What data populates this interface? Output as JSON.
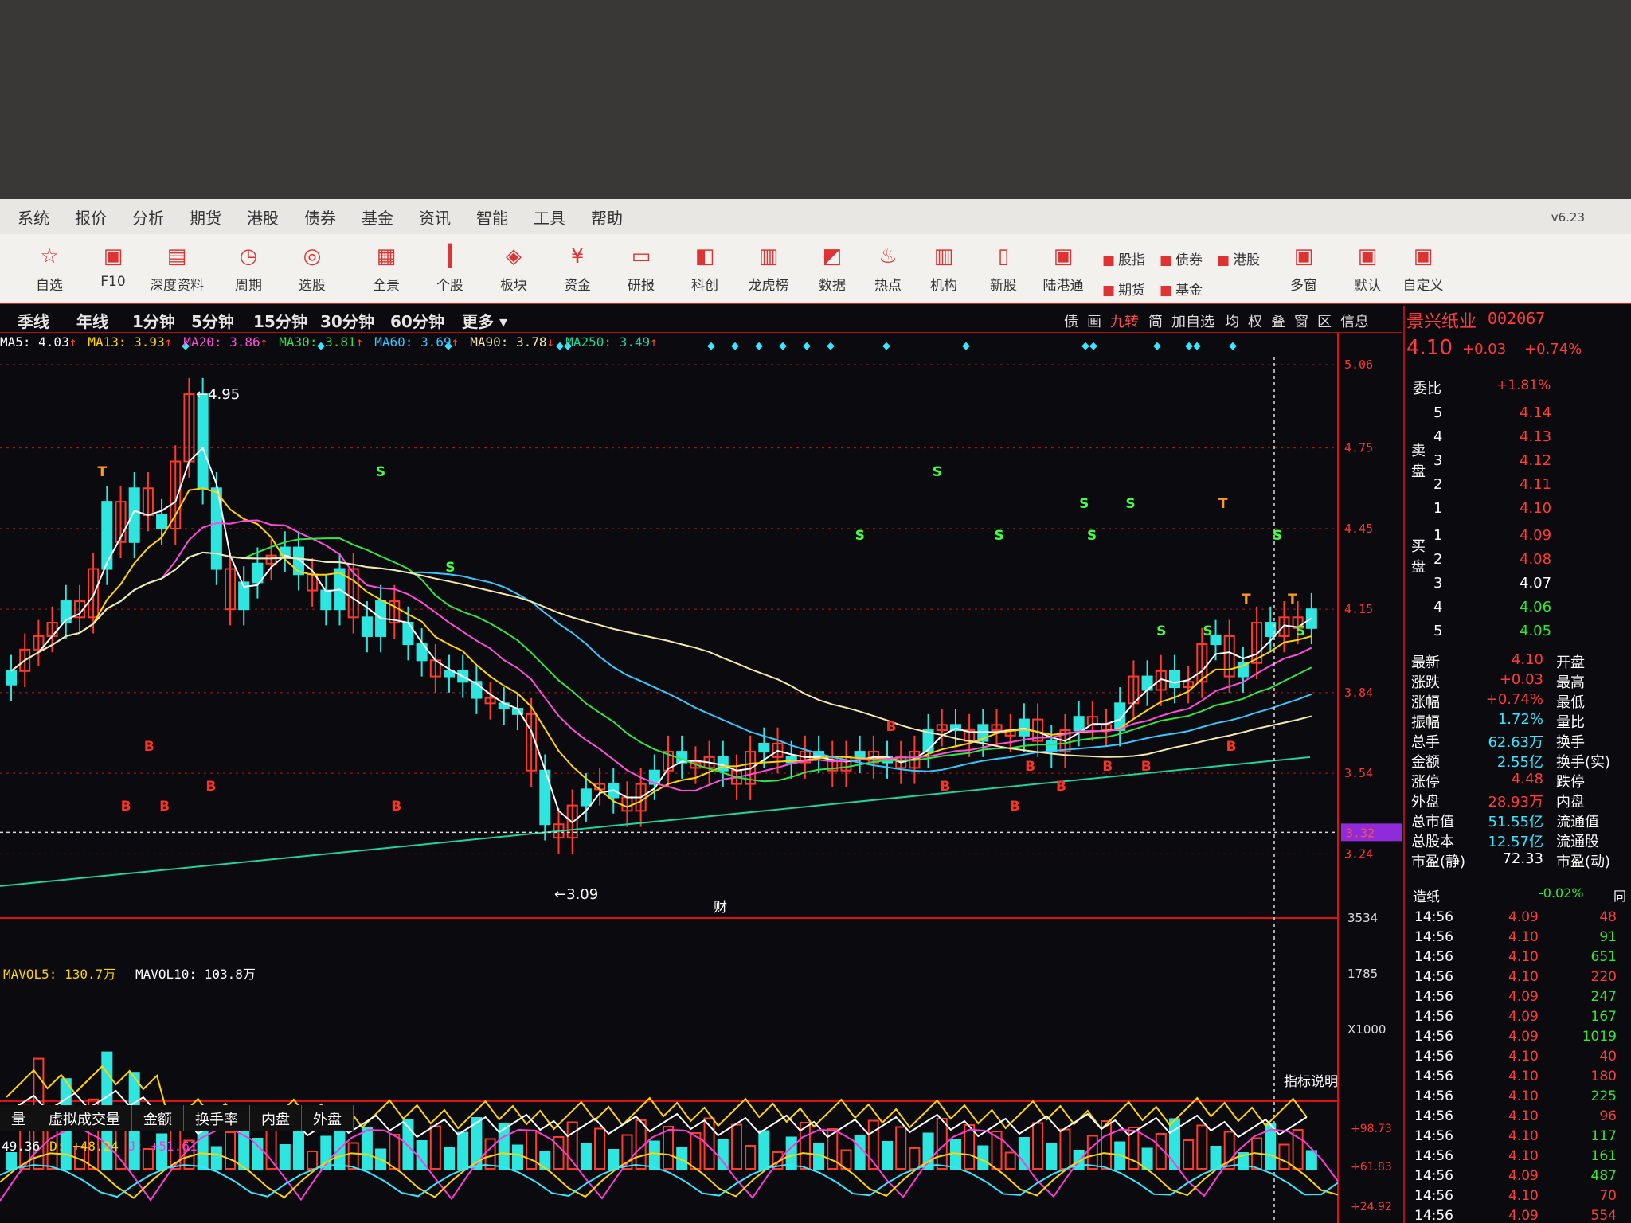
{
  "menu": [
    "系统",
    "报价",
    "分析",
    "期货",
    "港股",
    "债券",
    "基金",
    "资讯",
    "智能",
    "工具",
    "帮助"
  ],
  "version": "v6.23",
  "toolbar": [
    {
      "icon": "star-icon",
      "glyph": "☆",
      "label": "自选"
    },
    {
      "icon": "f10-icon",
      "glyph": "▣",
      "label": "F10"
    },
    {
      "icon": "f9-icon",
      "glyph": "▤",
      "label": "深度资料"
    },
    {
      "icon": "clock-icon",
      "glyph": "◷",
      "label": "周期"
    },
    {
      "icon": "select-stock-icon",
      "glyph": "◎",
      "label": "选股"
    },
    {
      "icon": "grid-icon",
      "glyph": "▦",
      "label": "全景"
    },
    {
      "icon": "candle-icon",
      "glyph": "┃",
      "label": "个股"
    },
    {
      "icon": "layers-icon",
      "glyph": "◈",
      "label": "板块"
    },
    {
      "icon": "yen-icon",
      "glyph": "¥",
      "label": "资金"
    },
    {
      "icon": "report-icon",
      "glyph": "▭",
      "label": "研报"
    },
    {
      "icon": "kechuang-icon",
      "glyph": "◧",
      "label": "科创"
    },
    {
      "icon": "bar-icon",
      "glyph": "▥",
      "label": "龙虎榜"
    },
    {
      "icon": "line-chart-icon",
      "glyph": "◩",
      "label": "数据"
    },
    {
      "icon": "fire-icon",
      "glyph": "♨",
      "label": "热点"
    },
    {
      "icon": "building-icon",
      "glyph": "▥",
      "label": "机构"
    },
    {
      "icon": "ipo-icon",
      "glyph": "▯",
      "label": "新股"
    },
    {
      "icon": "hk-connect-icon",
      "glyph": "▣",
      "label": "陆港通"
    }
  ],
  "toolbar_small": [
    "股指",
    "债券",
    "港股",
    "期货",
    "基金"
  ],
  "toolbar_right": [
    "多窗",
    "默认",
    "自定义"
  ],
  "periods": [
    "季线",
    "年线",
    "1分钟",
    "5分钟",
    "15分钟",
    "30分钟",
    "60分钟",
    "更多"
  ],
  "right_tools": [
    "债",
    "画",
    "九转",
    "简",
    "加自选",
    "均",
    "权",
    "叠",
    "窗",
    "区",
    "信息"
  ],
  "ma_legend": [
    {
      "text": "MA5: 4.03",
      "color": "#ffffff",
      "arrow": "↑"
    },
    {
      "text": "MA13: 3.93",
      "color": "#ffd400",
      "arrow": "↑"
    },
    {
      "text": "MA20: 3.86",
      "color": "#ff4fd8",
      "arrow": "↑"
    },
    {
      "text": "MA30: 3.81",
      "color": "#36e24a",
      "arrow": "↑"
    },
    {
      "text": "MA60: 3.69",
      "color": "#38c8ff",
      "arrow": "↑"
    },
    {
      "text": "MA90: 3.78",
      "color": "#f4e7b0",
      "arrow": "↓"
    },
    {
      "text": "MA250: 3.49",
      "color": "#22d39a",
      "arrow": "↑"
    }
  ],
  "price_axis": [
    "5.06",
    "4.75",
    "4.45",
    "4.15",
    "3.84",
    "3.54",
    "3.24"
  ],
  "crosshair_price": "3.32",
  "high_label": "4.95",
  "low_label": "3.09",
  "cai_label": "财",
  "vol_legend": {
    "mavol5": "MAVOL5: 130.7万",
    "mavol10": "MAVOL10: 103.8万"
  },
  "vol_axis": [
    "3534",
    "1785",
    "X1000"
  ],
  "kdj_legend": {
    "k": "49.36",
    "d": "D: +48.24",
    "j": "J: +51.61"
  },
  "kdj_axis": [
    "+98.73",
    "+61.83",
    "+24.92"
  ],
  "indicator_help": "指标说明",
  "subtabs": [
    "量",
    "虚拟成交量",
    "金额",
    "换手率",
    "内盘",
    "外盘"
  ],
  "stock": {
    "name": "景兴纸业",
    "code": "002067",
    "price": "4.10",
    "change": "+0.03",
    "pct": "+0.74%"
  },
  "weibi": {
    "label": "委比",
    "value": "+1.81%"
  },
  "sell_label": "卖盘",
  "buy_label": "买盘",
  "asks": [
    {
      "n": "5",
      "p": "4.14"
    },
    {
      "n": "4",
      "p": "4.13"
    },
    {
      "n": "3",
      "p": "4.12"
    },
    {
      "n": "2",
      "p": "4.11"
    },
    {
      "n": "1",
      "p": "4.10"
    }
  ],
  "bids": [
    {
      "n": "1",
      "p": "4.09"
    },
    {
      "n": "2",
      "p": "4.08"
    },
    {
      "n": "3",
      "p": "4.07"
    },
    {
      "n": "4",
      "p": "4.06"
    },
    {
      "n": "5",
      "p": "4.05"
    }
  ],
  "quote": [
    {
      "k": "最新",
      "v": "4.10",
      "k2": "开盘"
    },
    {
      "k": "涨跌",
      "v": "+0.03",
      "k2": "最高"
    },
    {
      "k": "涨幅",
      "v": "+0.74%",
      "k2": "最低"
    },
    {
      "k": "振幅",
      "v": "1.72%",
      "k2": "量比"
    },
    {
      "k": "总手",
      "v": "62.63万",
      "k2": "换手"
    },
    {
      "k": "金额",
      "v": "2.55亿",
      "k2": "换手(实)"
    },
    {
      "k": "涨停",
      "v": "4.48",
      "k2": "跌停"
    },
    {
      "k": "外盘",
      "v": "28.93万",
      "k2": "内盘"
    },
    {
      "k": "总市值",
      "v": "51.55亿",
      "k2": "流通值"
    },
    {
      "k": "总股本",
      "v": "12.57亿",
      "k2": "流通股"
    },
    {
      "k": "市盈(静)",
      "v": "72.33",
      "k2": "市盈(动)"
    }
  ],
  "sector": {
    "name": "造纸",
    "pct": "-0.02%",
    "extra": "同"
  },
  "ticks": [
    {
      "t": "14:56",
      "p": "4.09",
      "v": "48"
    },
    {
      "t": "14:56",
      "p": "4.10",
      "v": "91"
    },
    {
      "t": "14:56",
      "p": "4.10",
      "v": "651"
    },
    {
      "t": "14:56",
      "p": "4.10",
      "v": "220"
    },
    {
      "t": "14:56",
      "p": "4.09",
      "v": "247"
    },
    {
      "t": "14:56",
      "p": "4.09",
      "v": "167"
    },
    {
      "t": "14:56",
      "p": "4.09",
      "v": "1019"
    },
    {
      "t": "14:56",
      "p": "4.10",
      "v": "40"
    },
    {
      "t": "14:56",
      "p": "4.10",
      "v": "180"
    },
    {
      "t": "14:56",
      "p": "4.10",
      "v": "225"
    },
    {
      "t": "14:56",
      "p": "4.10",
      "v": "96"
    },
    {
      "t": "14:56",
      "p": "4.10",
      "v": "117"
    },
    {
      "t": "14:56",
      "p": "4.10",
      "v": "161"
    },
    {
      "t": "14:56",
      "p": "4.09",
      "v": "487"
    },
    {
      "t": "14:56",
      "p": "4.10",
      "v": "70"
    },
    {
      "t": "14:56",
      "p": "4.09",
      "v": "554"
    }
  ],
  "chart_data": {
    "type": "candlestick",
    "price_range": [
      3.09,
      5.06
    ],
    "candle_close": [
      3.92,
      4.0,
      4.05,
      4.1,
      4.18,
      4.12,
      4.3,
      4.55,
      4.4,
      4.6,
      4.5,
      4.45,
      4.7,
      4.95,
      4.6,
      4.3,
      4.15,
      4.25,
      4.32,
      4.35,
      4.38,
      4.28,
      4.22,
      4.15,
      4.3,
      4.12,
      4.05,
      4.18,
      4.1,
      4.02,
      3.96,
      3.9,
      3.92,
      3.88,
      3.82,
      3.8,
      3.78,
      3.76,
      3.55,
      3.35,
      3.3,
      3.42,
      3.48,
      3.5,
      3.45,
      3.4,
      3.5,
      3.55,
      3.62,
      3.58,
      3.56,
      3.6,
      3.55,
      3.5,
      3.62,
      3.65,
      3.6,
      3.58,
      3.62,
      3.6,
      3.55,
      3.6,
      3.62,
      3.58,
      3.6,
      3.56,
      3.62,
      3.7,
      3.72,
      3.7,
      3.66,
      3.72,
      3.7,
      3.68,
      3.74,
      3.66,
      3.62,
      3.7,
      3.75,
      3.72,
      3.7,
      3.8,
      3.9,
      3.85,
      3.92,
      3.86,
      3.88,
      4.02,
      4.05,
      3.9,
      3.95,
      4.1,
      4.05,
      4.12,
      4.08,
      4.15
    ],
    "candle_up": [
      false,
      true,
      true,
      true,
      false,
      true,
      true,
      false,
      true,
      false,
      true,
      false,
      true,
      true,
      false,
      false,
      true,
      false,
      false,
      true,
      false,
      false,
      true,
      false,
      false,
      true,
      false,
      false,
      true,
      false,
      false,
      true,
      false,
      false,
      false,
      true,
      false,
      false,
      true,
      false,
      true,
      true,
      false,
      true,
      false,
      true,
      true,
      false,
      true,
      false,
      true,
      true,
      false,
      true,
      true,
      false,
      true,
      false,
      true,
      false,
      true,
      true,
      false,
      true,
      false,
      true,
      true,
      false,
      true,
      false,
      true,
      false,
      true,
      true,
      false,
      true,
      false,
      true,
      false,
      true,
      true,
      false,
      true,
      false,
      true,
      false,
      true,
      true,
      false,
      true,
      false,
      true,
      false,
      true,
      true,
      false
    ],
    "markers": [
      {
        "i": 12,
        "t": "T"
      },
      {
        "i": 15,
        "t": "B"
      },
      {
        "i": 18,
        "t": "B"
      },
      {
        "i": 20,
        "t": "B"
      },
      {
        "i": 26,
        "t": "B"
      },
      {
        "i": 48,
        "t": "S"
      },
      {
        "i": 50,
        "t": "B"
      },
      {
        "i": 57,
        "t": "S"
      },
      {
        "i": 110,
        "t": "S"
      },
      {
        "i": 114,
        "t": "B"
      },
      {
        "i": 120,
        "t": "S"
      },
      {
        "i": 121,
        "t": "B"
      },
      {
        "i": 128,
        "t": "S"
      },
      {
        "i": 130,
        "t": "B"
      },
      {
        "i": 132,
        "t": "B"
      },
      {
        "i": 136,
        "t": "B"
      },
      {
        "i": 139,
        "t": "S"
      },
      {
        "i": 140,
        "t": "S"
      },
      {
        "i": 142,
        "t": "B"
      },
      {
        "i": 145,
        "t": "S"
      },
      {
        "i": 147,
        "t": "B"
      },
      {
        "i": 149,
        "t": "S"
      },
      {
        "i": 155,
        "t": "S"
      },
      {
        "i": 157,
        "t": "T"
      },
      {
        "i": 158,
        "t": "B"
      },
      {
        "i": 160,
        "t": "T"
      },
      {
        "i": 164,
        "t": "S"
      },
      {
        "i": 166,
        "t": "T"
      },
      {
        "i": 167,
        "t": "S"
      }
    ]
  }
}
